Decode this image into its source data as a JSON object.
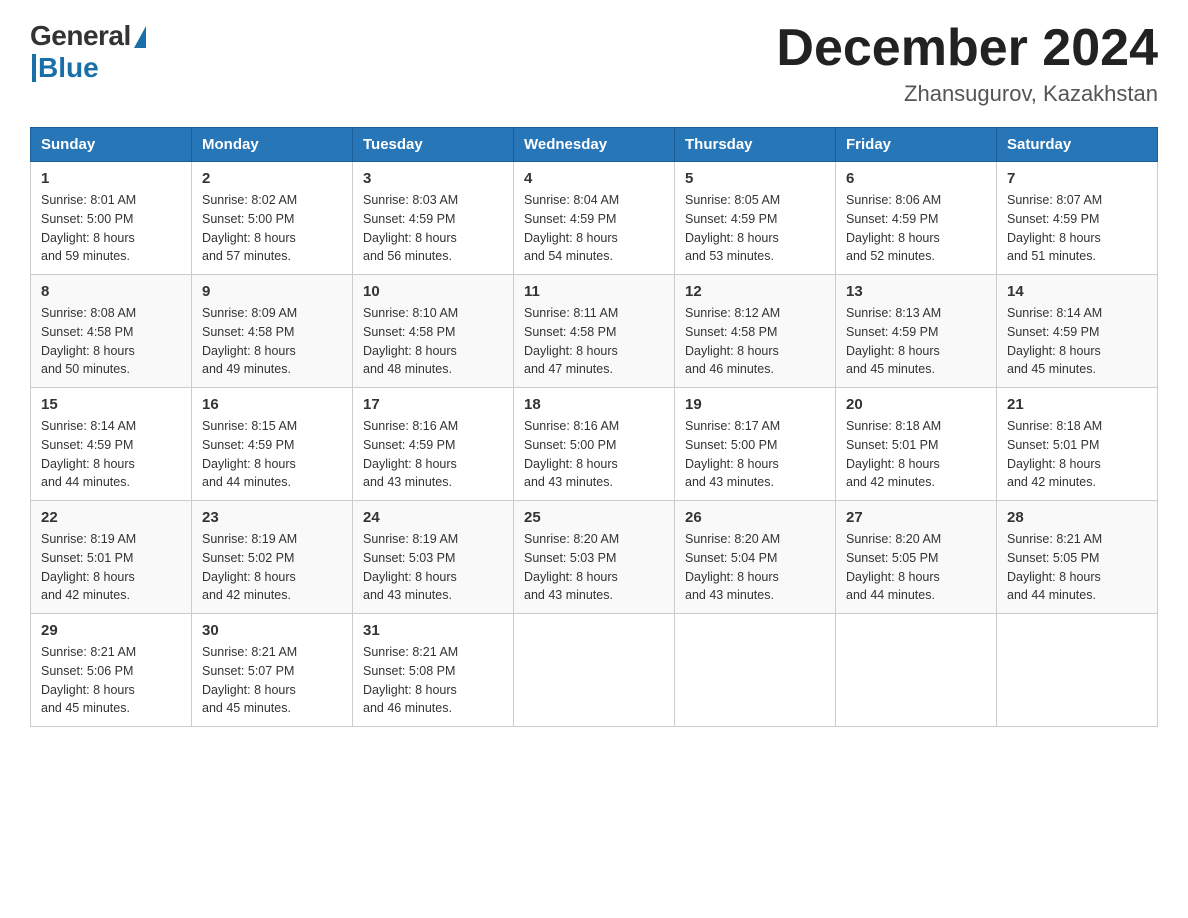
{
  "logo": {
    "general": "General",
    "blue": "Blue"
  },
  "title": {
    "month_year": "December 2024",
    "location": "Zhansugurov, Kazakhstan"
  },
  "headers": [
    "Sunday",
    "Monday",
    "Tuesday",
    "Wednesday",
    "Thursday",
    "Friday",
    "Saturday"
  ],
  "weeks": [
    [
      {
        "day": "1",
        "sunrise": "8:01 AM",
        "sunset": "5:00 PM",
        "daylight": "8 hours and 59 minutes."
      },
      {
        "day": "2",
        "sunrise": "8:02 AM",
        "sunset": "5:00 PM",
        "daylight": "8 hours and 57 minutes."
      },
      {
        "day": "3",
        "sunrise": "8:03 AM",
        "sunset": "4:59 PM",
        "daylight": "8 hours and 56 minutes."
      },
      {
        "day": "4",
        "sunrise": "8:04 AM",
        "sunset": "4:59 PM",
        "daylight": "8 hours and 54 minutes."
      },
      {
        "day": "5",
        "sunrise": "8:05 AM",
        "sunset": "4:59 PM",
        "daylight": "8 hours and 53 minutes."
      },
      {
        "day": "6",
        "sunrise": "8:06 AM",
        "sunset": "4:59 PM",
        "daylight": "8 hours and 52 minutes."
      },
      {
        "day": "7",
        "sunrise": "8:07 AM",
        "sunset": "4:59 PM",
        "daylight": "8 hours and 51 minutes."
      }
    ],
    [
      {
        "day": "8",
        "sunrise": "8:08 AM",
        "sunset": "4:58 PM",
        "daylight": "8 hours and 50 minutes."
      },
      {
        "day": "9",
        "sunrise": "8:09 AM",
        "sunset": "4:58 PM",
        "daylight": "8 hours and 49 minutes."
      },
      {
        "day": "10",
        "sunrise": "8:10 AM",
        "sunset": "4:58 PM",
        "daylight": "8 hours and 48 minutes."
      },
      {
        "day": "11",
        "sunrise": "8:11 AM",
        "sunset": "4:58 PM",
        "daylight": "8 hours and 47 minutes."
      },
      {
        "day": "12",
        "sunrise": "8:12 AM",
        "sunset": "4:58 PM",
        "daylight": "8 hours and 46 minutes."
      },
      {
        "day": "13",
        "sunrise": "8:13 AM",
        "sunset": "4:59 PM",
        "daylight": "8 hours and 45 minutes."
      },
      {
        "day": "14",
        "sunrise": "8:14 AM",
        "sunset": "4:59 PM",
        "daylight": "8 hours and 45 minutes."
      }
    ],
    [
      {
        "day": "15",
        "sunrise": "8:14 AM",
        "sunset": "4:59 PM",
        "daylight": "8 hours and 44 minutes."
      },
      {
        "day": "16",
        "sunrise": "8:15 AM",
        "sunset": "4:59 PM",
        "daylight": "8 hours and 44 minutes."
      },
      {
        "day": "17",
        "sunrise": "8:16 AM",
        "sunset": "4:59 PM",
        "daylight": "8 hours and 43 minutes."
      },
      {
        "day": "18",
        "sunrise": "8:16 AM",
        "sunset": "5:00 PM",
        "daylight": "8 hours and 43 minutes."
      },
      {
        "day": "19",
        "sunrise": "8:17 AM",
        "sunset": "5:00 PM",
        "daylight": "8 hours and 43 minutes."
      },
      {
        "day": "20",
        "sunrise": "8:18 AM",
        "sunset": "5:01 PM",
        "daylight": "8 hours and 42 minutes."
      },
      {
        "day": "21",
        "sunrise": "8:18 AM",
        "sunset": "5:01 PM",
        "daylight": "8 hours and 42 minutes."
      }
    ],
    [
      {
        "day": "22",
        "sunrise": "8:19 AM",
        "sunset": "5:01 PM",
        "daylight": "8 hours and 42 minutes."
      },
      {
        "day": "23",
        "sunrise": "8:19 AM",
        "sunset": "5:02 PM",
        "daylight": "8 hours and 42 minutes."
      },
      {
        "day": "24",
        "sunrise": "8:19 AM",
        "sunset": "5:03 PM",
        "daylight": "8 hours and 43 minutes."
      },
      {
        "day": "25",
        "sunrise": "8:20 AM",
        "sunset": "5:03 PM",
        "daylight": "8 hours and 43 minutes."
      },
      {
        "day": "26",
        "sunrise": "8:20 AM",
        "sunset": "5:04 PM",
        "daylight": "8 hours and 43 minutes."
      },
      {
        "day": "27",
        "sunrise": "8:20 AM",
        "sunset": "5:05 PM",
        "daylight": "8 hours and 44 minutes."
      },
      {
        "day": "28",
        "sunrise": "8:21 AM",
        "sunset": "5:05 PM",
        "daylight": "8 hours and 44 minutes."
      }
    ],
    [
      {
        "day": "29",
        "sunrise": "8:21 AM",
        "sunset": "5:06 PM",
        "daylight": "8 hours and 45 minutes."
      },
      {
        "day": "30",
        "sunrise": "8:21 AM",
        "sunset": "5:07 PM",
        "daylight": "8 hours and 45 minutes."
      },
      {
        "day": "31",
        "sunrise": "8:21 AM",
        "sunset": "5:08 PM",
        "daylight": "8 hours and 46 minutes."
      },
      null,
      null,
      null,
      null
    ]
  ],
  "labels": {
    "sunrise": "Sunrise:",
    "sunset": "Sunset:",
    "daylight": "Daylight:"
  }
}
